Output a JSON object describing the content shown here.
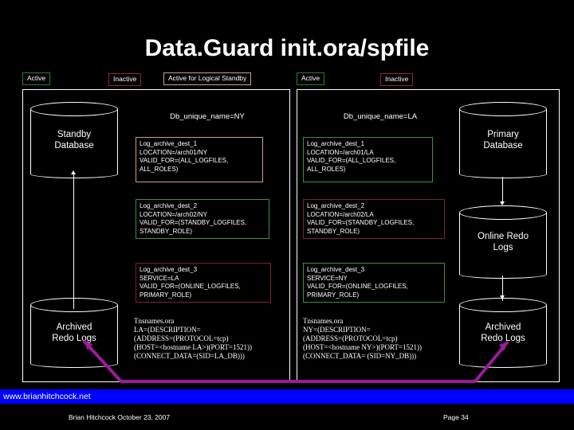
{
  "title": "Data.Guard init.ora/spfile",
  "legend": {
    "left_group": [
      {
        "label": "Active",
        "kind": "active"
      },
      {
        "label": "Inactive",
        "kind": "inactive"
      },
      {
        "label": "Active for Logical Standby",
        "kind": "logical"
      }
    ],
    "right_group": [
      {
        "label": "Active",
        "kind": "active"
      },
      {
        "label": "Inactive",
        "kind": "inactive"
      }
    ]
  },
  "left_panel": {
    "db_unique_name": "Db_unique_name=NY",
    "standby_db_label": "Standby\nDatabase",
    "archived_logs_label": "Archived\nRedo Logs",
    "dest1": "Log_archive_dest_1\nLOCATION=/arch01/NY\nVALID_FOR=(ALL_LOGFILES,\nALL_ROLES)",
    "dest2": "Log_archive_dest_2\nLOCATION=/arch02/NY\nVALID_FOR=(STANDBY_LOGFILES,\nSTANDBY_ROLE)",
    "dest3": "Log_archive_dest_3\nSERVICE=LA\nVALID_FOR=(ONLINE_LOGFILES,\nPRIMARY_ROLE)",
    "tnsnames": "Tnsnames.ora\nLA=(DESCRIPTION=\n(ADDRESS=(PROTOCOL=tcp)\n(HOST=<hostname LA>)(PORT=1521))\n(CONNECT_DATA=(SID=LA_DB)))"
  },
  "right_panel": {
    "db_unique_name": "Db_unique_name=LA",
    "primary_db_label": "Primary\nDatabase",
    "online_logs_label": "Online Redo\nLogs",
    "archived_logs_label": "Archived\nRedo Logs",
    "dest1": "Log_archive_dest_1\nLOCATION=/arch01/LA\nVALID_FOR=(ALL_LOGFILES,\nALL_ROLES)",
    "dest2": "Log_archive_dest_2\nLOCATION=/arch02/LA\nVALID_FOR=(STANDBY_LOGFILES,\nSTANDBY_ROLE)",
    "dest3": "Log_archive_dest_3\nSERVICE=NY\nVALID_FOR=(ONLINE_LOGFILES,\nPRIMARY_ROLE)",
    "tnsnames": "Tnsnames.ora\nNY=(DESCRIPTION=\n(ADDRESS=(PROTOCOL=tcp)\n(HOST=<hostname NY>)(PORT=1521))\n(CONNECT_DATA= (SID=NY_DB)))"
  },
  "footer": {
    "url": "www.brianhitchcock.net",
    "author_date": "Brian Hitchcock  October 23, 2007",
    "page": "Page 34"
  },
  "colors": {
    "active_border": "#3f8f43",
    "inactive_border": "#7e2230",
    "logical_border": "#c9a08c",
    "link_arrow": "#9b1b9b",
    "url_bar": "#0000ff",
    "background": "#000000",
    "foreground": "#ffffff"
  }
}
